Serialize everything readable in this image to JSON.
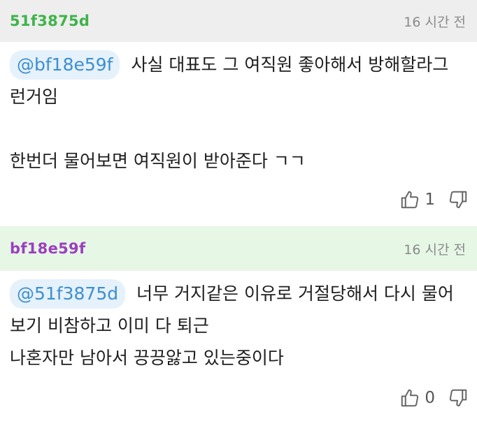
{
  "comments": [
    {
      "username": "51f3875d",
      "timestamp": "16 시간 전",
      "mention": "@bf18e59f",
      "line1": "사실 대표도 그 여직원 좋아해서 방해할라그",
      "line_rest": "런거임\n\n한번더 물어보면 여직원이 받아준다 ㄱㄱ",
      "likes": "1",
      "username_color": "#3fb34a"
    },
    {
      "username": "bf18e59f",
      "timestamp": "16 시간 전",
      "mention": "@51f3875d",
      "line1": "너무 거지같은 이유로 거절당해서 다시 물어",
      "line_rest": "보기 비참하고 이미 다 퇴근\n나혼자만 남아서 끙끙앓고 있는중이다",
      "likes": "0",
      "username_color": "#9c3fbf"
    }
  ],
  "icons": {
    "like": "thumbs-up-icon",
    "dislike": "thumbs-down-icon"
  }
}
